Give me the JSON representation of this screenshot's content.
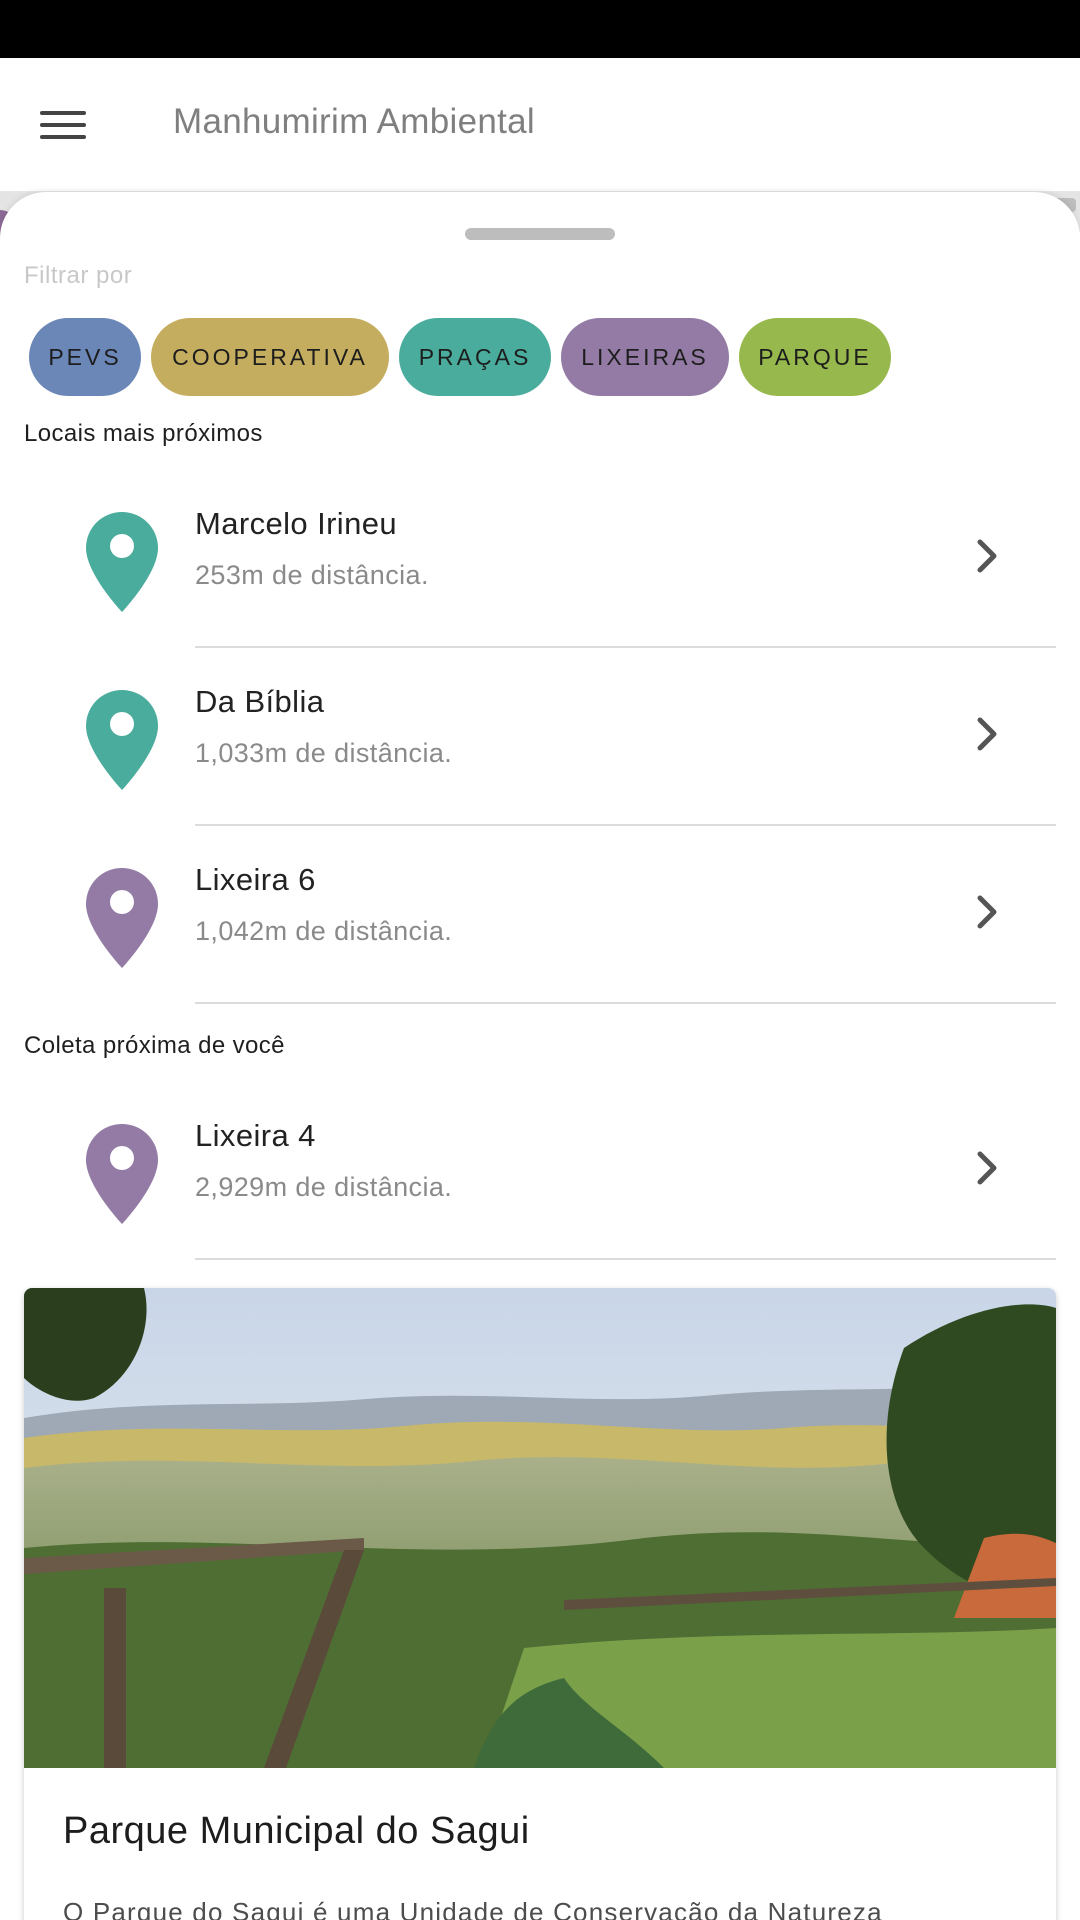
{
  "app": {
    "title": "Manhumirim Ambiental"
  },
  "filters": {
    "label": "Filtrar por",
    "chips": [
      {
        "label": "PEVS",
        "color": "#6b87b8"
      },
      {
        "label": "COOPERATIVA",
        "color": "#c5ad5f"
      },
      {
        "label": "PRAÇAS",
        "color": "#4aac9c"
      },
      {
        "label": "LIXEIRAS",
        "color": "#947ba5"
      },
      {
        "label": "PARQUE",
        "color": "#97b84d"
      }
    ]
  },
  "nearest": {
    "label": "Locais mais próximos",
    "items": [
      {
        "name": "Marcelo Irineu",
        "distance": "253m de distância.",
        "pin_color": "#4aac9c",
        "icon": "map-pin-icon"
      },
      {
        "name": "Da Bíblia",
        "distance": "1,033m de distância.",
        "pin_color": "#4aac9c",
        "icon": "map-pin-icon"
      },
      {
        "name": "Lixeira 6",
        "distance": "1,042m de distância.",
        "pin_color": "#947ba5",
        "icon": "map-pin-icon"
      }
    ]
  },
  "collection": {
    "label": "Coleta próxima de você",
    "items": [
      {
        "name": "Lixeira 4",
        "distance": "2,929m de distância.",
        "pin_color": "#947ba5",
        "icon": "map-pin-icon"
      }
    ]
  },
  "park": {
    "title": "Parque Municipal do Sagui",
    "description": "O Parque do Sagui é uma Unidade de Conservação da Natureza"
  }
}
